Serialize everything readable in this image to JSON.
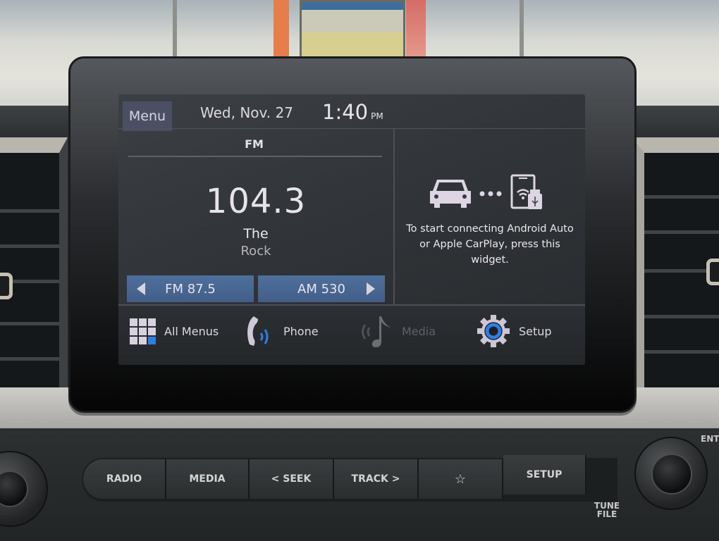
{
  "screen": {
    "topbar": {
      "menu_label": "Menu",
      "date": "Wed, Nov. 27",
      "time": "1:40",
      "ampm": "PM"
    },
    "radio": {
      "band": "FM",
      "frequency": "104.3",
      "station_line1": "The",
      "station_line2": "Rock",
      "prev_preset": "FM 87.5",
      "next_preset": "AM 530"
    },
    "projection": {
      "icons": [
        "car-icon",
        "dots-icon",
        "phone-wifi-usb-icon"
      ],
      "message": "To start connecting Android Auto or Apple CarPlay, press this widget."
    },
    "dock": [
      {
        "label": "All Menus",
        "icon": "grid-icon",
        "enabled": true
      },
      {
        "label": "Phone",
        "icon": "phone-icon",
        "enabled": true
      },
      {
        "label": "Media",
        "icon": "music-note-icon",
        "enabled": false
      },
      {
        "label": "Setup",
        "icon": "gear-icon",
        "enabled": true
      }
    ],
    "colors": {
      "accent_blue": "#2f7fe0",
      "preset_button": "#4a6894",
      "menu_button": "#4b4f64"
    }
  },
  "hardware": {
    "buttons": [
      "RADIO",
      "MEDIA",
      "< SEEK",
      "TRACK >",
      "☆",
      "SETUP"
    ],
    "tune_label_1": "TUNE",
    "tune_label_2": "FILE",
    "enter_label": "ENT"
  }
}
